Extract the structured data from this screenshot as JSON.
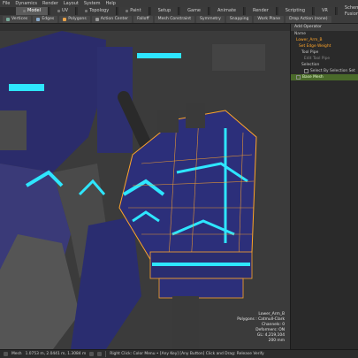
{
  "menus": [
    "File",
    "Dynamics",
    "Render",
    "Layout",
    "System",
    "Help"
  ],
  "tabs": [
    {
      "label": "Model",
      "active": true
    },
    {
      "label": "UV",
      "active": false
    },
    {
      "label": "Topology",
      "active": false
    },
    {
      "label": "Paint",
      "active": false
    },
    {
      "label": "Setup",
      "active": false
    },
    {
      "label": "Game",
      "active": false
    },
    {
      "label": "Animate",
      "active": false
    },
    {
      "label": "Render",
      "active": false
    },
    {
      "label": "Scripting",
      "active": false
    },
    {
      "label": "VR",
      "active": false
    },
    {
      "label": "Schematic Fusion",
      "active": false
    }
  ],
  "toolbar": {
    "vertices": "Vertices",
    "edges": "Edges",
    "polygons": "Polygons",
    "action_center": "Action Center",
    "falloff": "Falloff",
    "mesh_constraint": "Mesh Constraint",
    "symmetry": "Symmetry",
    "snapping": "Snapping",
    "work_plane": "Work Plane",
    "drop_action": "Drop Action (none)"
  },
  "panel": {
    "header": "Add Operator",
    "rows": [
      {
        "label": "Name",
        "highlight": false
      },
      {
        "label": "Lower_Arm_B",
        "highlight": false
      },
      {
        "label": "Set Edge Weight",
        "highlight": false
      },
      {
        "label": "Tool Pipe",
        "highlight": false
      },
      {
        "label": "Edit Tool Pipe",
        "highlight": false
      },
      {
        "label": "Selection",
        "highlight": false
      },
      {
        "label": "Select By Selection Set",
        "highlight": false
      },
      {
        "label": "Base Mesh",
        "highlight": true
      }
    ]
  },
  "viewport_info": {
    "item": "Lower_Arm_B",
    "polygons": "Polygons : Catmull-Clark",
    "channels": "Channels: 0",
    "deformers": "Deformers: ON",
    "gl": "GL: 4,219,104",
    "scale": "200 mm"
  },
  "status": {
    "mesh": "Mesh",
    "coords": "1.0753 m, 2.0441 m, 1.3084 m",
    "hint": "Right Click: Color Menu • [Any Key] [Any Button] Click and Drag: Release Verify"
  },
  "colors": {
    "cyan_glow": "#2ee6ff",
    "armor_blue": "#2c2f7a",
    "wire_orange": "#ffa52a",
    "highlight_green": "#4a6a2a"
  }
}
